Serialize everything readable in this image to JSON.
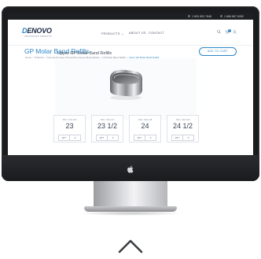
{
  "topbar": {
    "phone_1": "1 800 800 7848",
    "phone_2": "1 866 867 8282"
  },
  "header": {
    "logo_prefix": "D",
    "logo_text": "ENOVO",
    "tagline": "ORTHODONTIC PRODUCTS",
    "nav": [
      "PRODUCTS",
      "ABOUT US",
      "CONTACT"
    ],
    "cart_count": "0"
  },
  "page": {
    "title": "GP Molar Band Refills",
    "breadcrumb": [
      "Home",
      "Products",
      "General Purpose Primary/Permanent Molar Bands",
      "GP Molar Band Refills",
      "Upper GP Molar Band Refills"
    ],
    "add_to_cart": "ADD TO CART",
    "section_title": "Upper GP Molar Band Refills"
  },
  "cards": [
    {
      "sku": "SKU: 160-146",
      "size": "23",
      "qty_label": "QTY",
      "qty_value": "0"
    },
    {
      "sku": "SKU: 160-147",
      "size": "23 1/2",
      "qty_label": "QTY",
      "qty_value": "0"
    },
    {
      "sku": "SKU: 160-148",
      "size": "24",
      "qty_label": "QTY",
      "qty_value": "0"
    },
    {
      "sku": "SKU: 160-149",
      "size": "24 1/2",
      "qty_label": "QTY",
      "qty_value": "0"
    }
  ],
  "icons": {
    "phone": "phone-icon",
    "search": "search-icon",
    "cart": "cart-icon",
    "user": "user-icon",
    "apple": "apple-logo-icon",
    "scroll": "chevron-up-icon"
  },
  "colors": {
    "accent": "#2c86c7",
    "brand_dark": "#15253f",
    "bezel": "#1b1c1e"
  }
}
